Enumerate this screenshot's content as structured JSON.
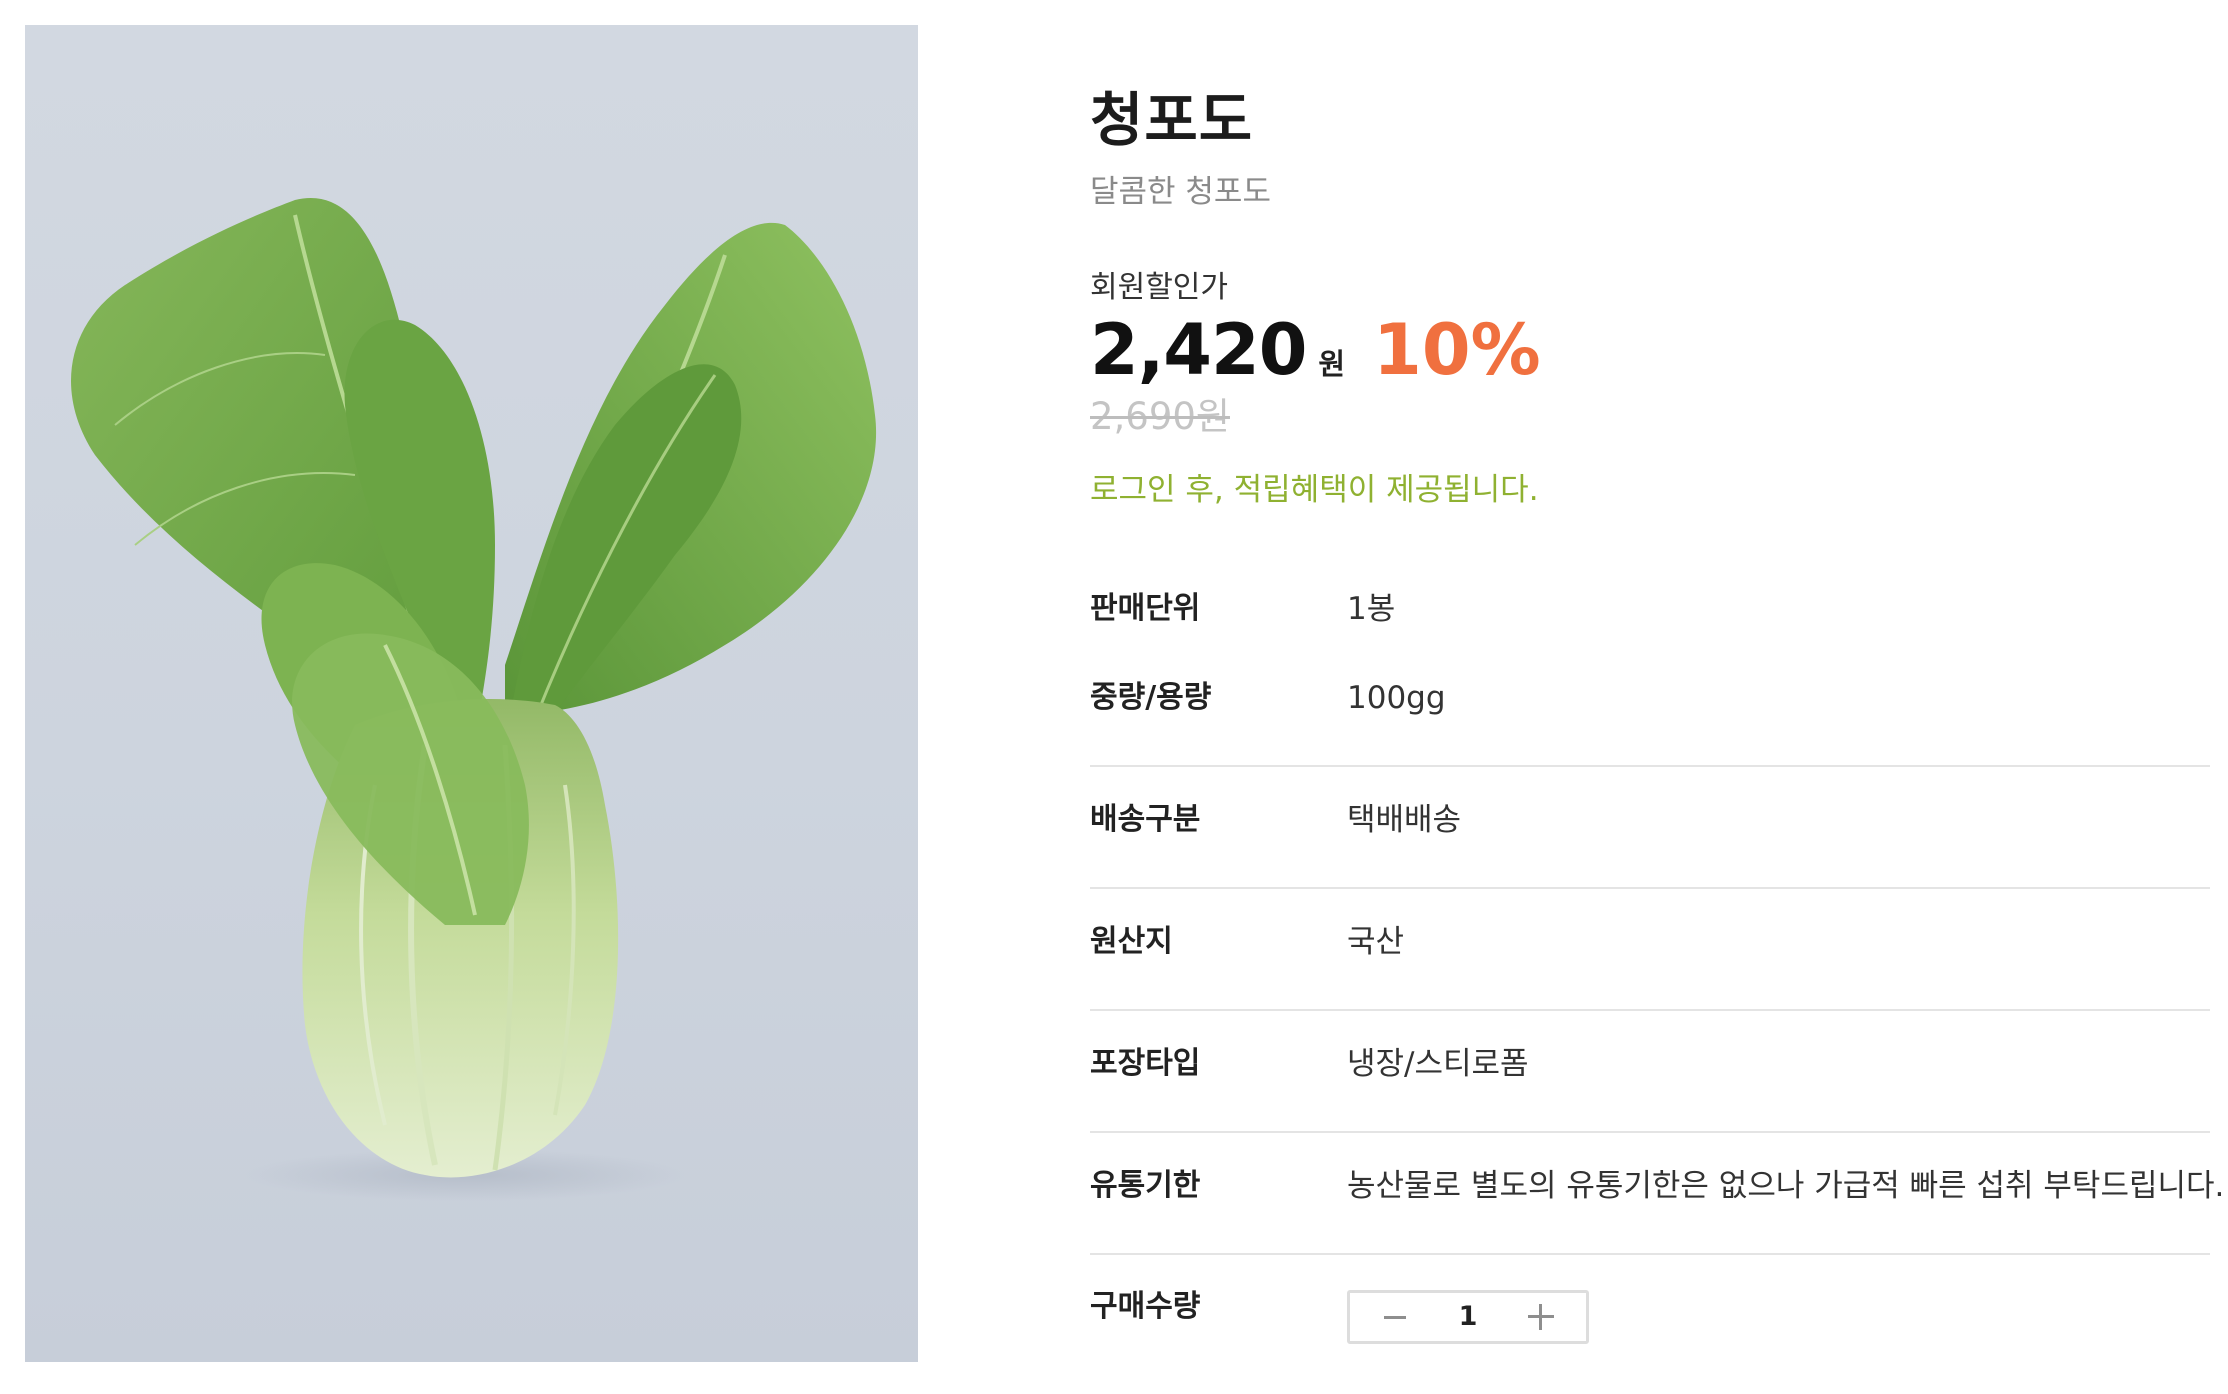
{
  "product": {
    "title": "청포도",
    "subtitle": "달콤한 청포도",
    "image_icon": "bok-choy-product-photo"
  },
  "price": {
    "label": "회원할인가",
    "value": "2,420",
    "unit": "원",
    "discount": "10%",
    "original": "2,690원",
    "discount_color": "#f0703f"
  },
  "point_notice": {
    "text": "로그인 후, 적립혜택이 제공됩니다.",
    "color": "#8fb131"
  },
  "specs": [
    {
      "label": "판매단위",
      "value": "1봉"
    },
    {
      "label": "중량/용량",
      "value": "100gg"
    },
    {
      "label": "배송구분",
      "value": "택배배송"
    },
    {
      "label": "원산지",
      "value": "국산"
    },
    {
      "label": "포장타입",
      "value": "냉장/스티로폼"
    },
    {
      "label": "유통기한",
      "value": "농산물로 별도의 유통기한은 없으나 가급적 빠른 섭취 부탁드립니다."
    }
  ],
  "quantity": {
    "label": "구매수량",
    "value": "1",
    "minus_icon": "minus-icon",
    "plus_icon": "plus-icon"
  }
}
